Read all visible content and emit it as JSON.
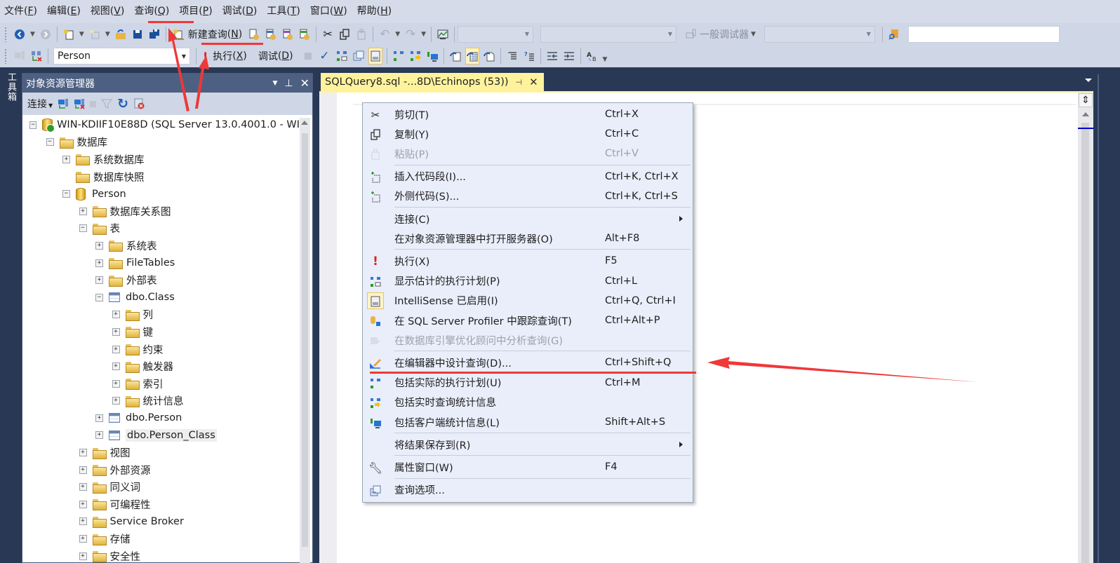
{
  "menubar": {
    "items": [
      {
        "label": "文件",
        "key": "F"
      },
      {
        "label": "编辑",
        "key": "E"
      },
      {
        "label": "视图",
        "key": "V"
      },
      {
        "label": "查询",
        "key": "Q"
      },
      {
        "label": "项目",
        "key": "P"
      },
      {
        "label": "调试",
        "key": "D"
      },
      {
        "label": "工具",
        "key": "T"
      },
      {
        "label": "窗口",
        "key": "W"
      },
      {
        "label": "帮助",
        "key": "H"
      }
    ]
  },
  "toolbar1": {
    "new_query_label": "新建查询",
    "new_query_key": "N",
    "debugger_label": "一般调试器"
  },
  "toolbar2": {
    "database_selected": "Person",
    "execute_label": "执行",
    "execute_key": "X",
    "debug_label": "调试",
    "debug_key": "D"
  },
  "toolstrip": {
    "label": "工具箱"
  },
  "object_explorer": {
    "title": "对象资源管理器",
    "connect_label": "连接",
    "tree": [
      {
        "level": 0,
        "expander": "minus",
        "icon": "server",
        "label": "WIN-KDIIF10E88D (SQL Server 13.0.4001.0 - WI"
      },
      {
        "level": 1,
        "expander": "minus",
        "icon": "folder",
        "label": "数据库"
      },
      {
        "level": 2,
        "expander": "plus",
        "icon": "folder",
        "label": "系统数据库"
      },
      {
        "level": 2,
        "expander": "none",
        "icon": "folder",
        "label": "数据库快照"
      },
      {
        "level": 2,
        "expander": "minus",
        "icon": "database",
        "label": "Person"
      },
      {
        "level": 3,
        "expander": "plus",
        "icon": "folder",
        "label": "数据库关系图"
      },
      {
        "level": 3,
        "expander": "minus",
        "icon": "folder",
        "label": "表"
      },
      {
        "level": 4,
        "expander": "plus",
        "icon": "folder",
        "label": "系统表"
      },
      {
        "level": 4,
        "expander": "plus",
        "icon": "folder",
        "label": "FileTables"
      },
      {
        "level": 4,
        "expander": "plus",
        "icon": "folder",
        "label": "外部表"
      },
      {
        "level": 4,
        "expander": "minus",
        "icon": "table",
        "label": "dbo.Class"
      },
      {
        "level": 5,
        "expander": "plus",
        "icon": "folder",
        "label": "列"
      },
      {
        "level": 5,
        "expander": "plus",
        "icon": "folder",
        "label": "键"
      },
      {
        "level": 5,
        "expander": "plus",
        "icon": "folder",
        "label": "约束"
      },
      {
        "level": 5,
        "expander": "plus",
        "icon": "folder",
        "label": "触发器"
      },
      {
        "level": 5,
        "expander": "plus",
        "icon": "folder",
        "label": "索引"
      },
      {
        "level": 5,
        "expander": "plus",
        "icon": "folder",
        "label": "统计信息"
      },
      {
        "level": 4,
        "expander": "plus",
        "icon": "table",
        "label": "dbo.Person"
      },
      {
        "level": 4,
        "expander": "plus",
        "icon": "table",
        "label": "dbo.Person_Class",
        "selected": true
      },
      {
        "level": 3,
        "expander": "plus",
        "icon": "folder",
        "label": "视图"
      },
      {
        "level": 3,
        "expander": "plus",
        "icon": "folder",
        "label": "外部资源"
      },
      {
        "level": 3,
        "expander": "plus",
        "icon": "folder",
        "label": "同义词"
      },
      {
        "level": 3,
        "expander": "plus",
        "icon": "folder",
        "label": "可编程性"
      },
      {
        "level": 3,
        "expander": "plus",
        "icon": "folder",
        "label": "Service Broker"
      },
      {
        "level": 3,
        "expander": "plus",
        "icon": "folder",
        "label": "存储"
      },
      {
        "level": 3,
        "expander": "plus",
        "icon": "folder",
        "label": "安全性"
      }
    ]
  },
  "document": {
    "tab_label": "SQLQuery8.sql -...8D\\Echinops (53))"
  },
  "context_menu": {
    "items": [
      {
        "type": "item",
        "icon": "cut",
        "label": "剪切(T)",
        "shortcut": "Ctrl+X"
      },
      {
        "type": "item",
        "icon": "copy",
        "label": "复制(Y)",
        "shortcut": "Ctrl+C"
      },
      {
        "type": "item",
        "icon": "paste",
        "label": "粘贴(P)",
        "shortcut": "Ctrl+V",
        "disabled": true
      },
      {
        "type": "sep"
      },
      {
        "type": "item",
        "icon": "insert-snippet",
        "label": "插入代码段(I)...",
        "shortcut": "Ctrl+K, Ctrl+X"
      },
      {
        "type": "item",
        "icon": "surround-with",
        "label": "外侧代码(S)...",
        "shortcut": "Ctrl+K, Ctrl+S"
      },
      {
        "type": "sep"
      },
      {
        "type": "item",
        "icon": "",
        "label": "连接(C)",
        "shortcut": "",
        "submenu": true
      },
      {
        "type": "item",
        "icon": "",
        "label": "在对象资源管理器中打开服务器(O)",
        "shortcut": "Alt+F8"
      },
      {
        "type": "sep"
      },
      {
        "type": "item",
        "icon": "execute",
        "label": "执行(X)",
        "shortcut": "F5"
      },
      {
        "type": "item",
        "icon": "estimated-plan",
        "label": "显示估计的执行计划(P)",
        "shortcut": "Ctrl+L"
      },
      {
        "type": "item",
        "icon": "intellisense",
        "label": "IntelliSense 已启用(I)",
        "shortcut": "Ctrl+Q, Ctrl+I",
        "checked": true
      },
      {
        "type": "item",
        "icon": "profiler",
        "label": "在 SQL Server Profiler 中跟踪查询(T)",
        "shortcut": "Ctrl+Alt+P"
      },
      {
        "type": "item",
        "icon": "tuning-advisor",
        "label": "在数据库引擎优化顾问中分析查询(G)",
        "shortcut": "",
        "disabled": true
      },
      {
        "type": "sep"
      },
      {
        "type": "item",
        "icon": "design-query",
        "label": "在编辑器中设计查询(D)...",
        "shortcut": "Ctrl+Shift+Q"
      },
      {
        "type": "item",
        "icon": "actual-plan",
        "label": "包括实际的执行计划(U)",
        "shortcut": "Ctrl+M"
      },
      {
        "type": "item",
        "icon": "live-stats",
        "label": "包括实时查询统计信息",
        "shortcut": ""
      },
      {
        "type": "item",
        "icon": "client-stats",
        "label": "包括客户端统计信息(L)",
        "shortcut": "Shift+Alt+S"
      },
      {
        "type": "sep"
      },
      {
        "type": "item",
        "icon": "",
        "label": "将结果保存到(R)",
        "shortcut": "",
        "submenu": true
      },
      {
        "type": "sep"
      },
      {
        "type": "item",
        "icon": "wrench",
        "label": "属性窗口(W)",
        "shortcut": "F4"
      },
      {
        "type": "sep"
      },
      {
        "type": "item",
        "icon": "query-options",
        "label": "查询选项...",
        "shortcut": ""
      }
    ]
  },
  "colors": {
    "chrome_dark": "#293955",
    "menubar": "#d6dbe9",
    "toolbar": "#cfd6e5",
    "tab_active": "#fff29d",
    "context_menu_bg": "#e9eefa",
    "annotation_red": "#ef3838"
  }
}
